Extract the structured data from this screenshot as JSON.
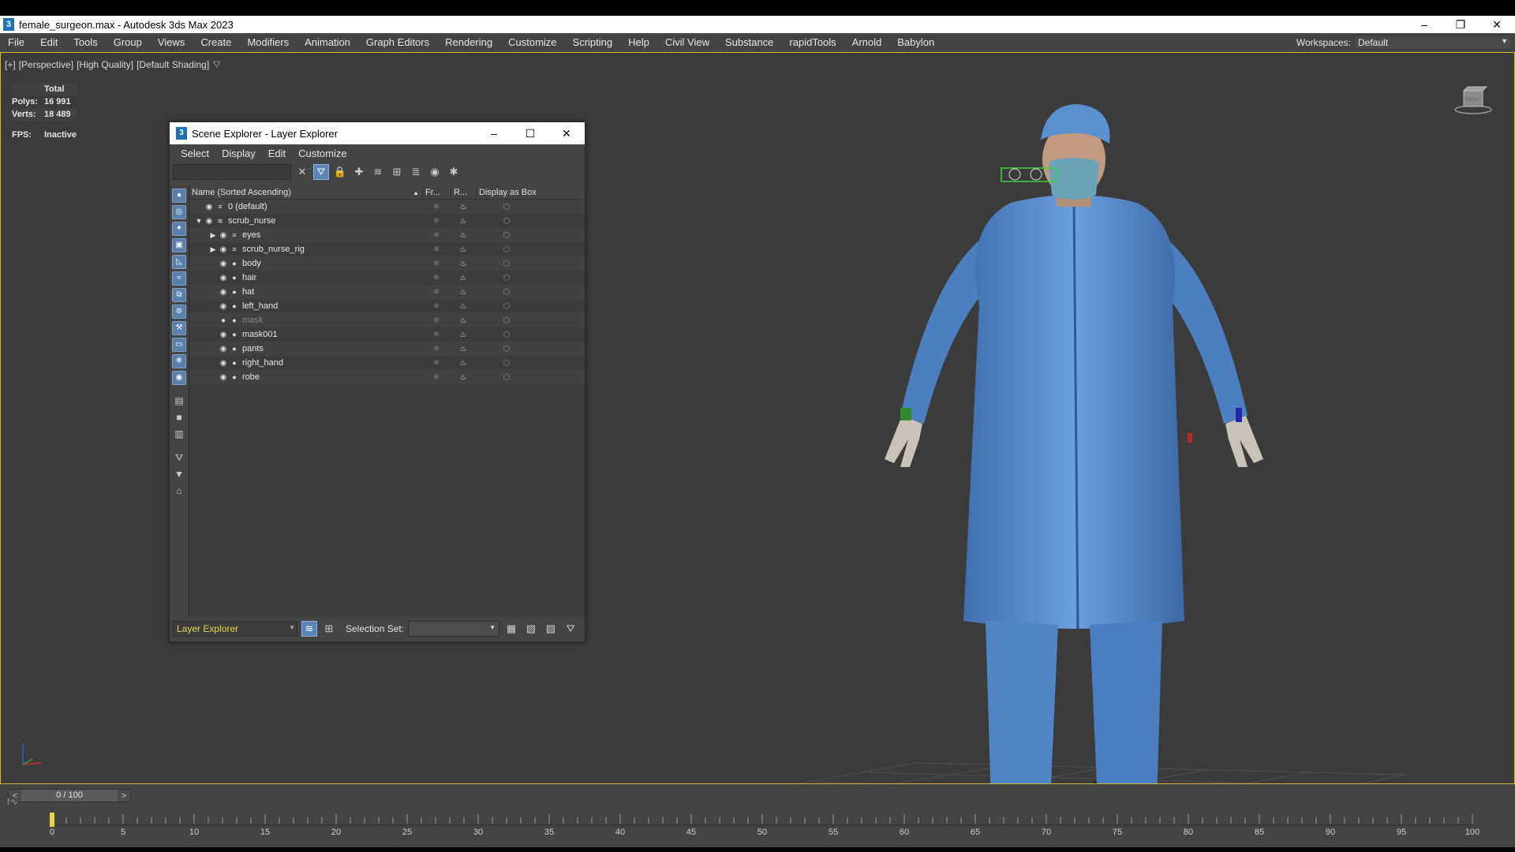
{
  "window": {
    "title": "female_surgeon.max - Autodesk 3ds Max 2023",
    "app_icon": "3",
    "controls": [
      "–",
      "❐",
      "✕"
    ]
  },
  "menu": {
    "items": [
      "File",
      "Edit",
      "Tools",
      "Group",
      "Views",
      "Create",
      "Modifiers",
      "Animation",
      "Graph Editors",
      "Rendering",
      "Customize",
      "Scripting",
      "Help",
      "Civil View",
      "Substance",
      "rapidTools",
      "Arnold",
      "Babylon"
    ],
    "workspaces_label": "Workspaces:",
    "workspace_value": "Default"
  },
  "viewport": {
    "label_plus": "[+]",
    "label_view": "[Perspective]",
    "label_quality": "[High Quality]",
    "label_shading": "[Default Shading]",
    "stats": {
      "total_label": "Total",
      "polys_label": "Polys:",
      "polys_value": "16 991",
      "verts_label": "Verts:",
      "verts_value": "18 489",
      "fps_label": "FPS:",
      "fps_value": "Inactive"
    },
    "viewcube_label": "FRONT"
  },
  "explorer": {
    "title": "Scene Explorer - Layer Explorer",
    "icon": "3",
    "menu": [
      "Select",
      "Display",
      "Edit",
      "Customize"
    ],
    "columns": {
      "name": "Name (Sorted Ascending)",
      "frozen": "Fr...",
      "render": "R...",
      "display_box": "Display as Box"
    },
    "rows": [
      {
        "label": "0 (default)",
        "indent": 0,
        "expander": "",
        "type": "layer",
        "visible": true
      },
      {
        "label": "scrub_nurse",
        "indent": 0,
        "expander": "▼",
        "type": "layer-active",
        "visible": true
      },
      {
        "label": "eyes",
        "indent": 1,
        "expander": "▶",
        "type": "layer",
        "visible": true
      },
      {
        "label": "scrub_nurse_rig",
        "indent": 1,
        "expander": "▶",
        "type": "layer",
        "visible": true
      },
      {
        "label": "body",
        "indent": 1,
        "expander": "",
        "type": "object",
        "visible": true
      },
      {
        "label": "hair",
        "indent": 1,
        "expander": "",
        "type": "object",
        "visible": true
      },
      {
        "label": "hat",
        "indent": 1,
        "expander": "",
        "type": "object",
        "visible": true
      },
      {
        "label": "left_hand",
        "indent": 1,
        "expander": "",
        "type": "object",
        "visible": true
      },
      {
        "label": "mask",
        "indent": 1,
        "expander": "",
        "type": "object",
        "visible": false
      },
      {
        "label": "mask001",
        "indent": 1,
        "expander": "",
        "type": "object",
        "visible": true
      },
      {
        "label": "pants",
        "indent": 1,
        "expander": "",
        "type": "object",
        "visible": true
      },
      {
        "label": "right_hand",
        "indent": 1,
        "expander": "",
        "type": "object",
        "visible": true
      },
      {
        "label": "robe",
        "indent": 1,
        "expander": "",
        "type": "object",
        "visible": true
      }
    ],
    "footer": {
      "explorer_mode": "Layer Explorer",
      "selection_set_label": "Selection Set:"
    }
  },
  "timeline": {
    "frame_display": "0 / 100",
    "prev": "<",
    "next": ">",
    "ticks": [
      "0",
      "5",
      "10",
      "15",
      "20",
      "25",
      "30",
      "35",
      "40",
      "45",
      "50",
      "55",
      "60",
      "65",
      "70",
      "75",
      "80",
      "85",
      "90",
      "95",
      "100"
    ]
  },
  "colors": {
    "viewport_bg": "#3b3b3b",
    "active_border": "#d6b53b",
    "scrubs_blue": "#5a8fd0",
    "explorer_mode_text": "#e8d54a"
  }
}
